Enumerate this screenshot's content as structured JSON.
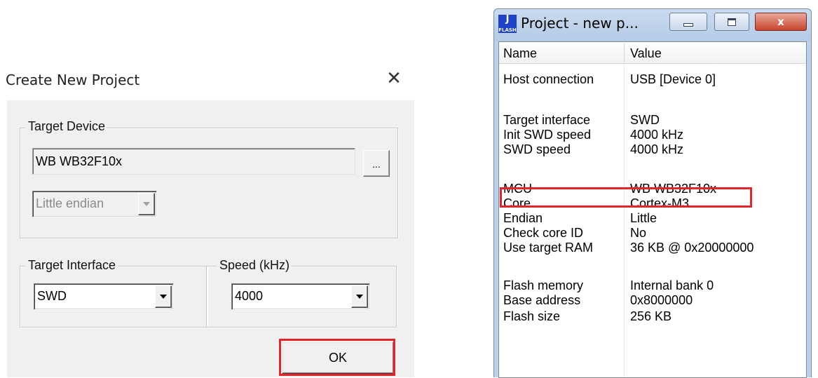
{
  "dialog": {
    "title": "Create New Project",
    "close_glyph": "✕",
    "target_device": {
      "legend": "Target Device",
      "device_value": "WB WB32F10x",
      "browse_label": "...",
      "endian_value": "Little endian"
    },
    "target_interface": {
      "legend": "Target Interface",
      "value": "SWD"
    },
    "speed": {
      "legend": "Speed (kHz)",
      "value": "4000"
    },
    "ok_label": "OK",
    "highlight_color": "#e3242b"
  },
  "window": {
    "title": "Project - new p...",
    "icon_text_top": "J",
    "icon_text_bottom": "FLASH",
    "close_glyph": "x",
    "columns": [
      "Name",
      "Value"
    ],
    "rows": [
      {
        "name": "Host connection",
        "value": "USB [Device 0]"
      },
      {
        "name": "",
        "value": ""
      },
      {
        "name": "Target interface",
        "value": "SWD"
      },
      {
        "name": "Init SWD speed",
        "value": "4000 kHz"
      },
      {
        "name": "SWD speed",
        "value": "4000 kHz"
      },
      {
        "name": "",
        "value": ""
      },
      {
        "name": "MCU",
        "value": "WB WB32F10x"
      },
      {
        "name": "Core",
        "value": "Cortex-M3"
      },
      {
        "name": "Endian",
        "value": "Little"
      },
      {
        "name": "Check core ID",
        "value": "No"
      },
      {
        "name": "Use target RAM",
        "value": "36 KB @ 0x20000000"
      },
      {
        "name": "",
        "value": ""
      },
      {
        "name": "Flash memory",
        "value": "Internal bank 0"
      },
      {
        "name": "Base address",
        "value": "0x8000000"
      },
      {
        "name": "Flash size",
        "value": "256 KB"
      }
    ]
  }
}
